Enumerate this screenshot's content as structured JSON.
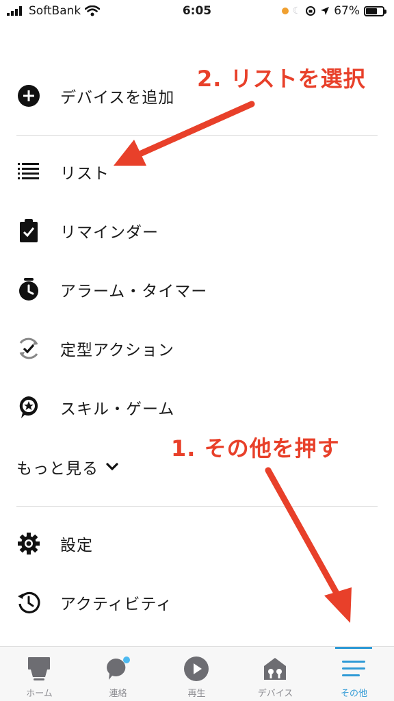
{
  "status_bar": {
    "carrier": "SoftBank",
    "time": "6:05",
    "battery_percent": "67%",
    "battery_level": 0.67,
    "indicator_dot_color": "#f0a030"
  },
  "menu": {
    "items": [
      {
        "label": "デバイスを追加",
        "icon": "add-circle-icon"
      },
      {
        "label": "リスト",
        "icon": "list-icon"
      },
      {
        "label": "リマインダー",
        "icon": "clipboard-check-icon"
      },
      {
        "label": "アラーム・タイマー",
        "icon": "alarm-clock-icon"
      },
      {
        "label": "定型アクション",
        "icon": "routine-icon"
      },
      {
        "label": "スキル・ゲーム",
        "icon": "skill-badge-icon"
      }
    ],
    "more_label": "もっと見る",
    "bottom_items": [
      {
        "label": "設定",
        "icon": "gear-icon"
      },
      {
        "label": "アクティビティ",
        "icon": "history-icon"
      }
    ]
  },
  "annotations": {
    "step2": "2. リストを選択",
    "step1": "1. その他を押す",
    "color": "#e8402a"
  },
  "tab_bar": {
    "tabs": [
      {
        "label": "ホーム",
        "icon": "home-icon"
      },
      {
        "label": "連絡",
        "icon": "chat-bubble-icon"
      },
      {
        "label": "再生",
        "icon": "play-icon"
      },
      {
        "label": "デバイス",
        "icon": "devices-icon"
      },
      {
        "label": "その他",
        "icon": "menu-icon"
      }
    ],
    "active_tab": "その他",
    "active_color": "#2f9ad6"
  }
}
